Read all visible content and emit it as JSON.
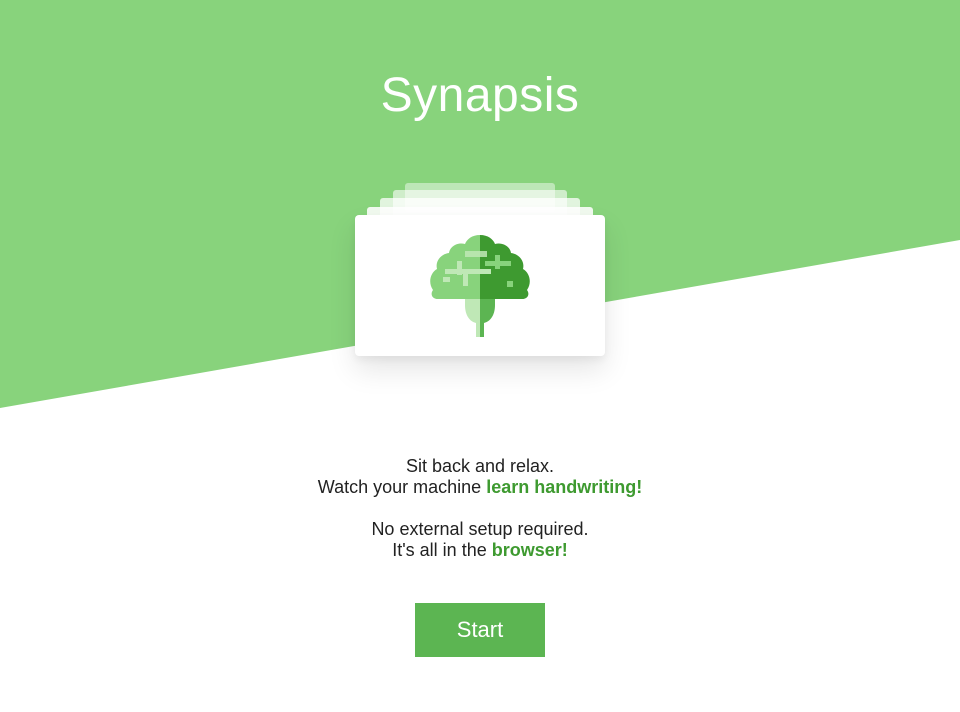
{
  "app": {
    "title": "Synapsis"
  },
  "hero": {
    "icon": "brain-tree-icon"
  },
  "intro": {
    "line1": "Sit back and relax.",
    "line2_prefix": "Watch your machine ",
    "line2_highlight": "learn handwriting!",
    "line3": "No external setup required.",
    "line4_prefix": "It's all in the ",
    "line4_highlight": "browser!"
  },
  "actions": {
    "start_label": "Start"
  },
  "colors": {
    "hero_green": "#88d37c",
    "accent_green": "#3e9a30",
    "button_green": "#5cb552",
    "text_dark": "#222222",
    "background": "#ffffff"
  }
}
